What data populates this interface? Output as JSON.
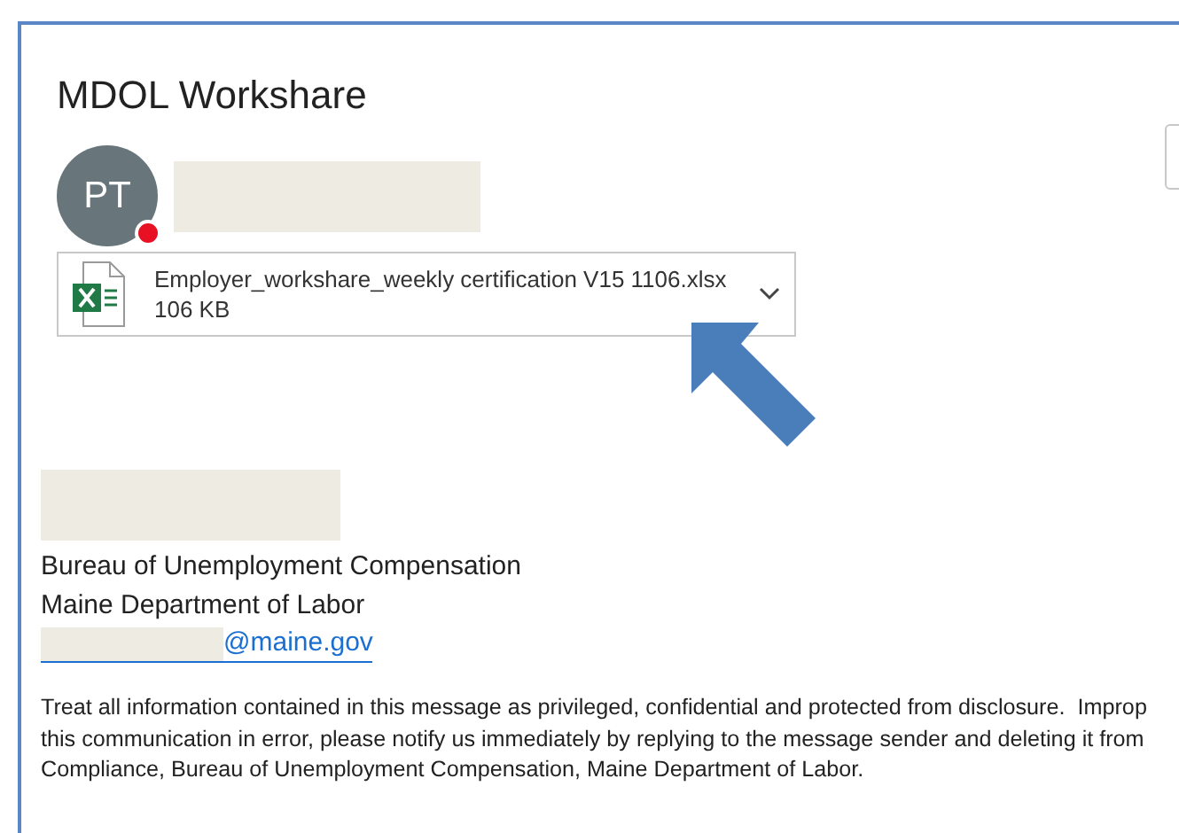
{
  "message": {
    "subject": "MDOL Workshare",
    "sender": {
      "initials": "PT"
    },
    "attachment": {
      "name": "Employer_workshare_weekly certification V15 1106.xlsx",
      "size": "106 KB"
    },
    "signature": [
      "Bureau of Unemployment Compensation",
      "Maine Department of Labor"
    ],
    "email_link": "@maine.gov",
    "disclaimer": [
      "Treat all information contained in this message as privileged, confidential and protected from disclosure.  Improp",
      "this communication in error, please notify us immediately by replying to the message sender and deleting it from",
      "Compliance, Bureau of Unemployment Compensation, Maine Department of Labor."
    ]
  }
}
